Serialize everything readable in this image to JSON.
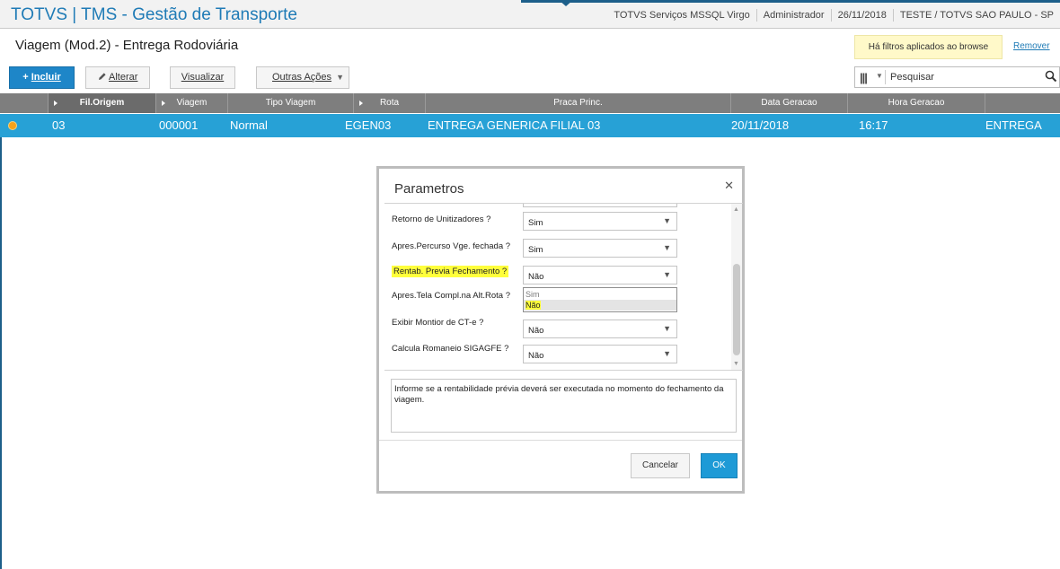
{
  "app": {
    "title": "TOTVS | TMS - Gestão de Transporte",
    "status": [
      "TOTVS Serviços MSSQL Virgo",
      "Administrador",
      "26/11/2018",
      "TESTE / TOTVS SAO PAULO - SP"
    ]
  },
  "header": {
    "page_title": "Viagem (Mod.2) - Entrega Rodoviária",
    "filter_notice": "Há filtros aplicados ao browse",
    "remove_link": "Remover"
  },
  "toolbar": {
    "incluir": "Incluir",
    "alterar": "Alterar",
    "visualizar": "Visualizar",
    "outras": "Outras Ações",
    "search_placeholder": "Pesquisar"
  },
  "grid": {
    "columns": [
      "Fil.Origem",
      "Viagem",
      "Tipo Viagem",
      "Rota",
      "Praca Princ.",
      "Data Geracao",
      "Hora Geracao"
    ],
    "rows": [
      [
        "03",
        "000001",
        "Normal",
        "EGEN03",
        "ENTREGA GENERICA FILIAL 03",
        "20/11/2018",
        "16:17",
        "ENTREGA"
      ]
    ]
  },
  "dialog": {
    "title": "Parametros",
    "params": [
      {
        "label": "Retorno de Unitizadores ?",
        "value": "Sim"
      },
      {
        "label": "Apres.Percurso Vge. fechada ?",
        "value": "Sim"
      },
      {
        "label": "Rentab. Previa Fechamento ?",
        "value": "Não"
      },
      {
        "label": "Apres.Tela Compl.na Alt.Rota ?",
        "value": ""
      },
      {
        "label": "Exibir Montior de CT-e ?",
        "value": "Não"
      },
      {
        "label": "Calcula Romaneio SIGAGFE ?",
        "value": "Não"
      }
    ],
    "dropdown_options": [
      "Sim",
      "Não"
    ],
    "help_text": "Informe se a rentabilidade prévia deverá ser executada no momento do fechamento da viagem.",
    "cancel_label": "Cancelar",
    "ok_label": "OK"
  },
  "colors": {
    "title_blue": "#1f7bb6",
    "row_selected": "#27a1d6",
    "header_gray": "#7e7e7e",
    "primary_button": "#1e86c8",
    "highlight": "#ffff3b",
    "status_dot": "#f6a21a"
  },
  "icons": [
    "close-icon",
    "search-icon",
    "columns-icon",
    "plus-icon",
    "pencil-icon",
    "chevron-down-icon",
    "status-dot-icon"
  ]
}
